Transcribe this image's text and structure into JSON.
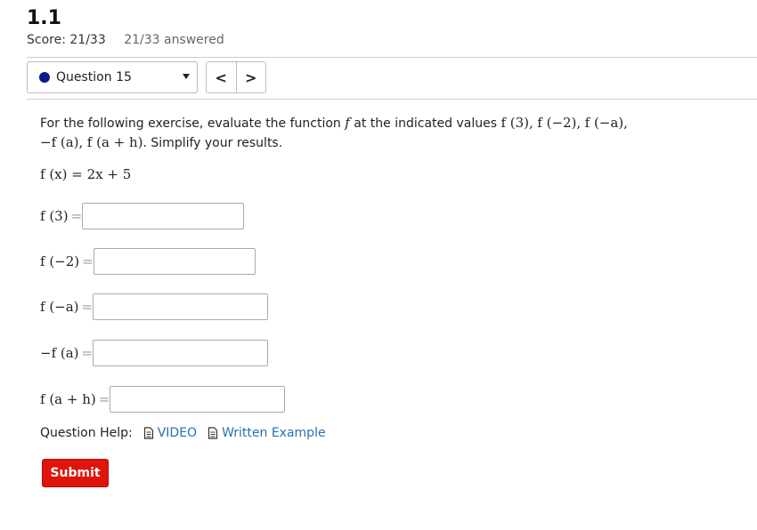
{
  "header": {
    "title": "1.1",
    "score": "Score: 21/33",
    "answered": "21/33 answered"
  },
  "nav": {
    "question_select": "Question 15",
    "prev": "<",
    "next": ">"
  },
  "question": {
    "prompt_text": "For the following exercise, evaluate the function",
    "prompt_tail": "at the indicated values",
    "simplify": ". Simplify your results.",
    "f": "f",
    "v1": "f (3),",
    "v2": "f (−2),",
    "v3": "f (−a),",
    "v4": "−f (a),",
    "v5": "f (a + h)",
    "function": "f (x) = 2x + 5",
    "parts": [
      {
        "label": "f (3)",
        "eq": "=",
        "value": ""
      },
      {
        "label": "f (−2)",
        "eq": "=",
        "value": ""
      },
      {
        "label": "f (−a)",
        "eq": "=",
        "value": ""
      },
      {
        "label": "−f (a)",
        "eq": "=",
        "value": ""
      },
      {
        "label": "f (a + h)",
        "eq": "=",
        "value": ""
      }
    ]
  },
  "help": {
    "label": "Question Help:",
    "video": "VIDEO",
    "example": "Written Example"
  },
  "submit_label": "Submit",
  "colors": {
    "accent": "#e0140a",
    "link": "#2a6fb0",
    "question_dot": "#0b1a8c"
  }
}
